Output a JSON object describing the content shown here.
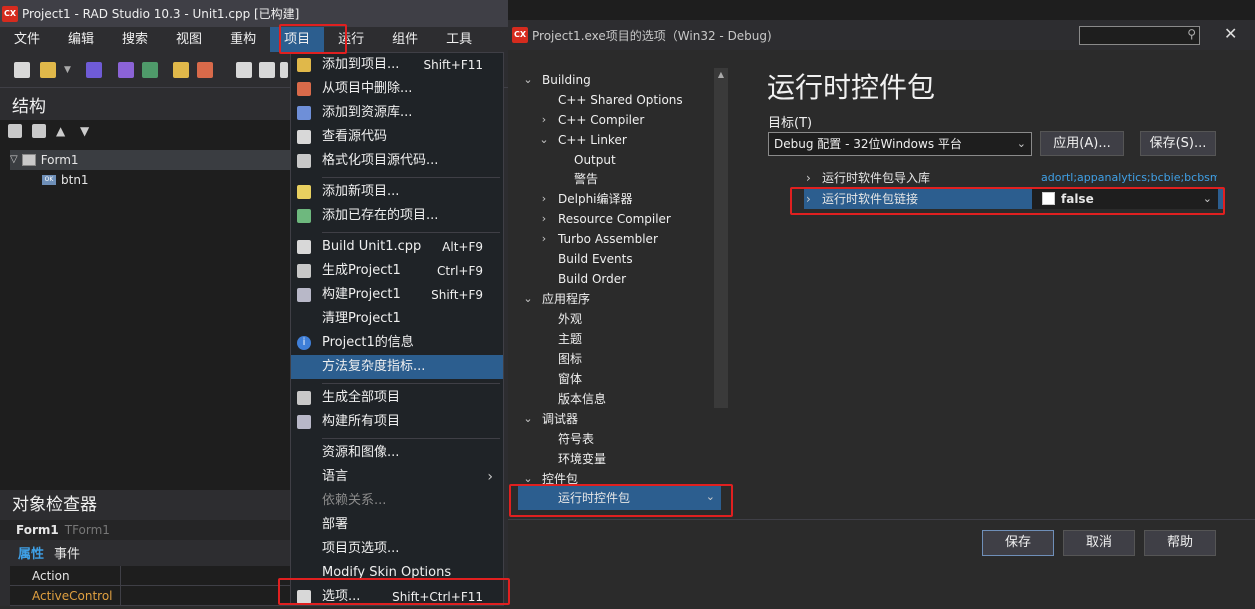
{
  "ide": {
    "title": "Project1 - RAD Studio 10.3 - Unit1.cpp [已构建]",
    "logo": "CX",
    "menu": [
      "文件",
      "编辑",
      "搜索",
      "视图",
      "重构",
      "项目",
      "运行",
      "组件",
      "工具"
    ],
    "structure": {
      "title": "结构",
      "tree": [
        {
          "label": "Form1"
        },
        {
          "label": "btn1",
          "icon_text": "OK"
        }
      ]
    },
    "object_inspector": {
      "title": "对象检查器",
      "selected_name": "Form1",
      "selected_type": "TForm1",
      "tabs": [
        "属性",
        "事件"
      ],
      "rows": [
        "Action",
        "ActiveControl"
      ]
    }
  },
  "project_menu": {
    "items": [
      {
        "label": "添加到项目...",
        "shortcut": "Shift+F11",
        "icon": "add-to-project-icon"
      },
      {
        "label": "从项目中删除...",
        "shortcut": "",
        "icon": "remove-from-project-icon"
      },
      {
        "label": "添加到资源库...",
        "shortcut": "",
        "icon": "add-to-repository-icon"
      },
      {
        "label": "查看源代码",
        "shortcut": "",
        "icon": "view-source-icon"
      },
      {
        "label": "格式化项目源代码...",
        "shortcut": "",
        "icon": "format-source-icon"
      },
      {
        "label": "添加新项目...",
        "shortcut": "",
        "icon": "add-new-project-icon"
      },
      {
        "label": "添加已存在的项目...",
        "shortcut": "",
        "icon": "add-existing-project-icon"
      },
      {
        "label": "Build Unit1.cpp",
        "shortcut": "Alt+F9",
        "icon": "build-unit-icon"
      },
      {
        "label": "生成Project1",
        "shortcut": "Ctrl+F9",
        "icon": "make-project-icon"
      },
      {
        "label": "构建Project1",
        "shortcut": "Shift+F9",
        "icon": "build-project-icon"
      },
      {
        "label": "清理Project1",
        "shortcut": "",
        "icon": ""
      },
      {
        "label": "Project1的信息",
        "shortcut": "",
        "icon": "info-icon"
      },
      {
        "label": "方法复杂度指标...",
        "shortcut": "",
        "icon": ""
      },
      {
        "label": "生成全部项目",
        "shortcut": "",
        "icon": "make-all-icon"
      },
      {
        "label": "构建所有项目",
        "shortcut": "",
        "icon": "build-all-icon"
      },
      {
        "label": "资源和图像...",
        "shortcut": "",
        "icon": ""
      },
      {
        "label": "语言",
        "shortcut": "",
        "icon": ""
      },
      {
        "label": "依赖关系...",
        "shortcut": "",
        "icon": ""
      },
      {
        "label": "部署",
        "shortcut": "",
        "icon": ""
      },
      {
        "label": "项目页选项...",
        "shortcut": "",
        "icon": ""
      },
      {
        "label": "Modify Skin Options",
        "shortcut": "",
        "icon": ""
      },
      {
        "label": "选项...",
        "shortcut": "Shift+Ctrl+F11",
        "icon": "options-icon"
      }
    ]
  },
  "dialog": {
    "title": "Project1.exe项目的选项（Win32 - Debug)",
    "logo": "CX",
    "tree": [
      {
        "label": "Building"
      },
      {
        "label": "C++ Shared Options"
      },
      {
        "label": "C++ Compiler"
      },
      {
        "label": "C++ Linker"
      },
      {
        "label": "Output"
      },
      {
        "label": "警告"
      },
      {
        "label": "Delphi编译器"
      },
      {
        "label": "Resource Compiler"
      },
      {
        "label": "Turbo Assembler"
      },
      {
        "label": "Build Events"
      },
      {
        "label": "Build Order"
      },
      {
        "label": "应用程序"
      },
      {
        "label": "外观"
      },
      {
        "label": "主题"
      },
      {
        "label": "图标"
      },
      {
        "label": "窗体"
      },
      {
        "label": "版本信息"
      },
      {
        "label": "调试器"
      },
      {
        "label": "符号表"
      },
      {
        "label": "环境变量"
      },
      {
        "label": "控件包"
      }
    ],
    "selected_node": "运行时控件包",
    "heading": "运行时控件包",
    "target_label": "目标(T)",
    "target_value": "Debug 配置 - 32位Windows 平台",
    "apply_button": "应用(A)...",
    "save_button": "保存(S)...",
    "properties": [
      {
        "name": "运行时软件包导入库",
        "value": "adortl;appanalytics;bcbie;bcbsmp"
      },
      {
        "name": "运行时软件包链接",
        "value": "false"
      }
    ],
    "buttons": {
      "save": "保存",
      "cancel": "取消",
      "help": "帮助"
    }
  }
}
